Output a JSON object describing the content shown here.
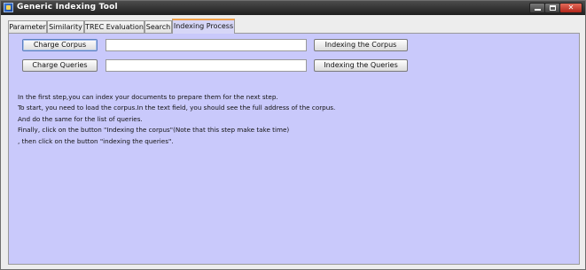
{
  "window": {
    "title": "Generic Indexing Tool",
    "icon": "app-icon",
    "controls": [
      "minimize-icon",
      "maximize-icon",
      "close-icon"
    ],
    "close_glyph": "✕"
  },
  "tabs": [
    {
      "label": "Parameter",
      "active": false
    },
    {
      "label": "Similarity",
      "active": false
    },
    {
      "label": "TREC Evaluation",
      "active": false
    },
    {
      "label": "Search",
      "active": false
    },
    {
      "label": "Indexing Process",
      "active": true
    }
  ],
  "indexing": {
    "charge_corpus_label": "Charge Corpus",
    "corpus_path_value": "",
    "indexing_corpus_label": "Indexing  the  Corpus",
    "charge_queries_label": "Charge Queries",
    "queries_path_value": "",
    "indexing_queries_label": "Indexing  the  Queries",
    "instructions": [
      "In the first step,you can index  your  documents to prepare them for the next step.",
      "To start, you need to load  the corpus.In the text field, you should see the full address of the corpus.",
      "And do the same for the list of queries.",
      "Finally, click on the button \"Indexing the  corpus\"(Note that this step make take time)",
      ", then click on the button \"indexing the queries\"."
    ]
  },
  "colors": {
    "panel_background": "#c9c9fb",
    "active_tab_accent": "#f2a24a",
    "titlebar": "#2a2a2a",
    "close_button": "#c83a2a"
  }
}
